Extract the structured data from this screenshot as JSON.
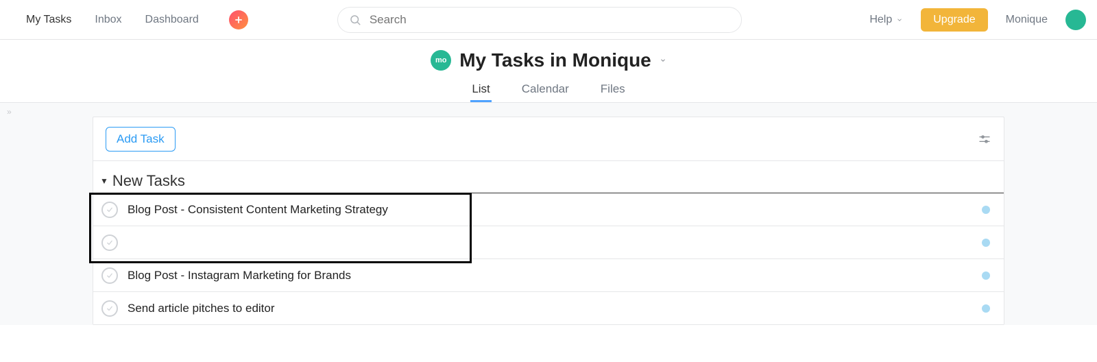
{
  "nav": {
    "my_tasks": "My Tasks",
    "inbox": "Inbox",
    "dashboard": "Dashboard"
  },
  "search": {
    "placeholder": "Search"
  },
  "topbar": {
    "help": "Help",
    "upgrade": "Upgrade",
    "username": "Monique"
  },
  "header": {
    "avatar_initials": "mo",
    "title": "My Tasks in Monique",
    "tabs": {
      "list": "List",
      "calendar": "Calendar",
      "files": "Files"
    }
  },
  "toolbar": {
    "add_task": "Add Task"
  },
  "section": {
    "name": "New Tasks"
  },
  "tasks": [
    {
      "title": "Blog Post - Consistent Content Marketing Strategy"
    },
    {
      "title": ""
    },
    {
      "title": "Blog Post - Instagram Marketing for Brands"
    },
    {
      "title": "Send article pitches to editor"
    }
  ],
  "colors": {
    "upgrade": "#f2b53a",
    "accent": "#4fa3ff",
    "avatar": "#27b894",
    "task_dot": "#a9daf3"
  }
}
